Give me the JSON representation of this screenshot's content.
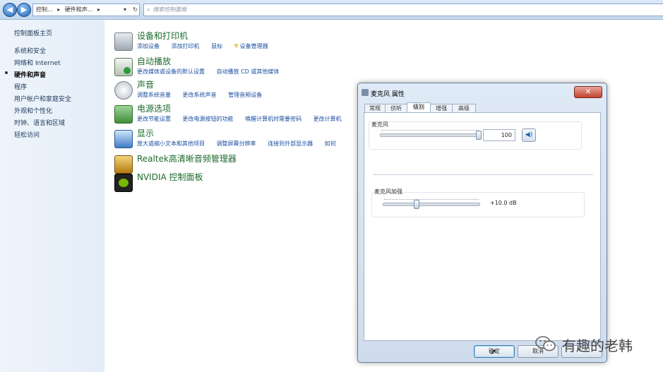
{
  "address_bar": {
    "breadcrumb": [
      "控制...",
      "硬件和声...",
      ""
    ],
    "search_placeholder": "搜索控制面板"
  },
  "sidebar": {
    "items": [
      {
        "label": "控制面板主页",
        "active": false
      },
      {
        "label": "系统和安全",
        "active": false
      },
      {
        "label": "网络和 Internet",
        "active": false
      },
      {
        "label": "硬件和声音",
        "active": true
      },
      {
        "label": "程序",
        "active": false
      },
      {
        "label": "用户帐户和家庭安全",
        "active": false
      },
      {
        "label": "外观和个性化",
        "active": false
      },
      {
        "label": "时钟、语言和区域",
        "active": false
      },
      {
        "label": "轻松访问",
        "active": false
      }
    ]
  },
  "categories": [
    {
      "title": "设备和打印机",
      "links": [
        "添加设备",
        "添加打印机",
        "鼠标",
        "设备管理器"
      ]
    },
    {
      "title": "自动播放",
      "links": [
        "更改媒体或设备的默认设置",
        "自动播放 CD 或其他媒体"
      ]
    },
    {
      "title": "声音",
      "links": [
        "调整系统音量",
        "更改系统声音",
        "管理音频设备"
      ]
    },
    {
      "title": "电源选项",
      "links": [
        "更改节能设置",
        "更改电源按钮的功能",
        "唤醒计算机时需要密码",
        "更改计算机"
      ]
    },
    {
      "title": "显示",
      "links": [
        "放大或缩小文本和其他项目",
        "调整屏幕分辨率",
        "连接到外部显示器",
        "如何"
      ]
    },
    {
      "title": "Realtek高清晰音频管理器",
      "links": []
    },
    {
      "title": "NVIDIA 控制面板",
      "links": []
    }
  ],
  "dialog": {
    "title": "麦克风 属性",
    "close_label": "✕",
    "tabs": [
      {
        "label": "常规",
        "selected": false
      },
      {
        "label": "侦听",
        "selected": false
      },
      {
        "label": "级别",
        "selected": true
      },
      {
        "label": "增强",
        "selected": false
      },
      {
        "label": "高级",
        "selected": false
      }
    ],
    "mic": {
      "label": "麦克风",
      "value": "100",
      "level_fraction": 1.0
    },
    "boost": {
      "label": "麦克风加强",
      "value": "+10.0 dB",
      "level_fraction": 0.33
    },
    "buttons": {
      "ok": "确定",
      "cancel": "取消"
    }
  },
  "watermark": {
    "text": "有趣的老韩"
  },
  "colors": {
    "link": "#1a4fa0",
    "category_title": "#1a6a2a",
    "close_button": "#c5432f"
  }
}
